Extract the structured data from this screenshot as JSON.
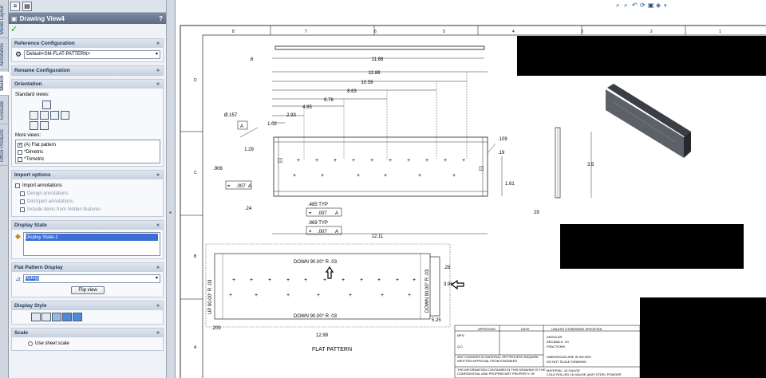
{
  "tabs": [
    "Model Layout",
    "Annotation",
    "Sketch",
    "Evaluate",
    "Office Products"
  ],
  "panel": {
    "title": "Drawing View4",
    "help": "?",
    "ok_icon": "✓",
    "reference_configuration": {
      "heading": "Reference Configuration",
      "value": "Default<SM-FLAT-PATTERN>"
    },
    "rename_configuration": {
      "heading": "Rename Configuration"
    },
    "orientation": {
      "heading": "Orientation",
      "standard_views_label": "Standard views:",
      "more_views_label": "More views:",
      "more_views": [
        "(A) Flat pattern",
        "*Dimetric",
        "*Trimetric"
      ]
    },
    "import_options": {
      "heading": "Import options",
      "items": [
        "Import annotations",
        "Design annotations",
        "DimXpert annotations",
        "Include items from hidden features"
      ]
    },
    "display_state": {
      "heading": "Display State",
      "item": "Display State-1"
    },
    "flat_pattern_display": {
      "heading": "Flat Pattern Display",
      "value": "0(deg)",
      "button": "Flip view"
    },
    "display_style": {
      "heading": "Display Style"
    },
    "scale": {
      "heading": "Scale",
      "option": "Use sheet scale"
    }
  },
  "drawing": {
    "border_columns": [
      "8",
      "7",
      "6",
      "5",
      "4",
      "3",
      "2",
      "1"
    ],
    "border_rows": [
      "D",
      "C",
      "B",
      "A"
    ],
    "top_view_dims": [
      ".6",
      "11.88",
      "12.88",
      "10.59",
      "8.63",
      "6.76",
      "4.85",
      "2.93",
      "1.02",
      "1.29",
      ".906",
      ".24",
      "12.11"
    ],
    "hole_callout": "Ø.157",
    "datum_label": "A",
    "feature_controls": [
      ".007",
      ".007",
      ".007"
    ],
    "typ_labels": [
      ".485 TYP",
      ".969 TYP"
    ],
    "right_dims": [
      ".109",
      ".19",
      "1.61",
      "3.5"
    ],
    "iso_dim": "29",
    "flat_bends": [
      "DOWN 90.00° R .03",
      "DOWN 90.00° R .03",
      "UP 90.00° R .03",
      "DOWN 90.00° R .03"
    ],
    "flat_dims": [
      ".28",
      "3.96",
      "12.99",
      "5.25",
      ".209"
    ],
    "flat_view_label": "FLAT PATTERN",
    "title_block": {
      "approved": "APPROVED",
      "date": "DATE",
      "unless": "UNLESS OTHERWISE SPECIFIED",
      "rows": [
        "MFG",
        "Q.C.",
        "ANY CHANGES IN MATERIAL OR PROCESS REQUIRE",
        "WRITTEN APPROVAL FROM ENGINEER",
        "THE INFORMATION CONTAINED IN THIS DRAWING IS THE",
        "CONFIDENTIAL AND PROPRIETARY PROPERTY OF"
      ],
      "tolerances": [
        "ANGULAR",
        "DECIMALS .XX",
        "FRACTIONS"
      ],
      "dim_note": "DIMENSIONS ARE IN INCHES",
      "do_not_scale": "DO NOT SCALE DRAWING",
      "material_label": "MATERIAL: 16 GAUGE",
      "material": "COLD ROLLED 16 GAUGE (AKF) STEEL POWDER"
    }
  }
}
